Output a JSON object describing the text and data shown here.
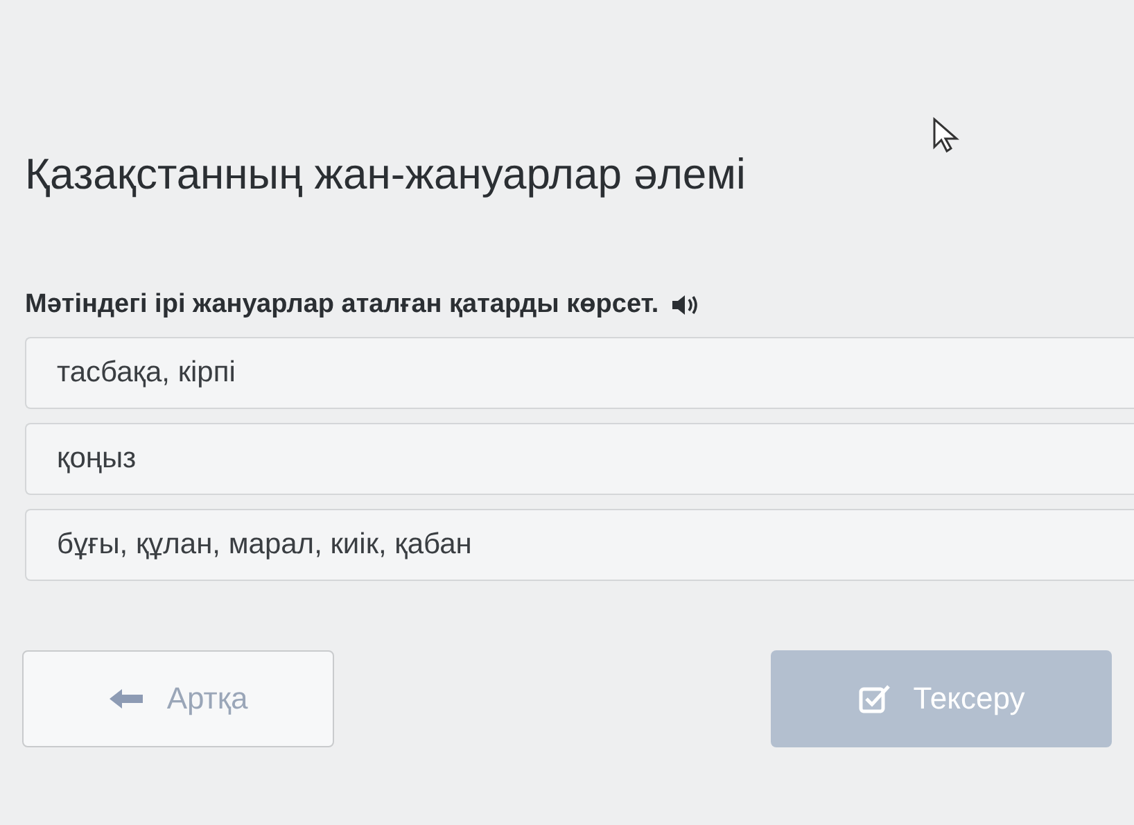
{
  "title": "Қазақстанның жан-жануарлар әлемі",
  "question": {
    "text": "Мәтіндегі ірі жануарлар аталған қатарды көрсет.",
    "audio": true
  },
  "options": [
    {
      "label": "тасбақа, кірпі",
      "selected": false
    },
    {
      "label": "қоңыз",
      "selected": false
    },
    {
      "label": "бұғы, құлан, марал, киік, қабан",
      "selected": false
    }
  ],
  "buttons": {
    "back": {
      "label": "Артқа",
      "disabled": false
    },
    "check": {
      "label": "Тексеру",
      "disabled": true
    }
  }
}
